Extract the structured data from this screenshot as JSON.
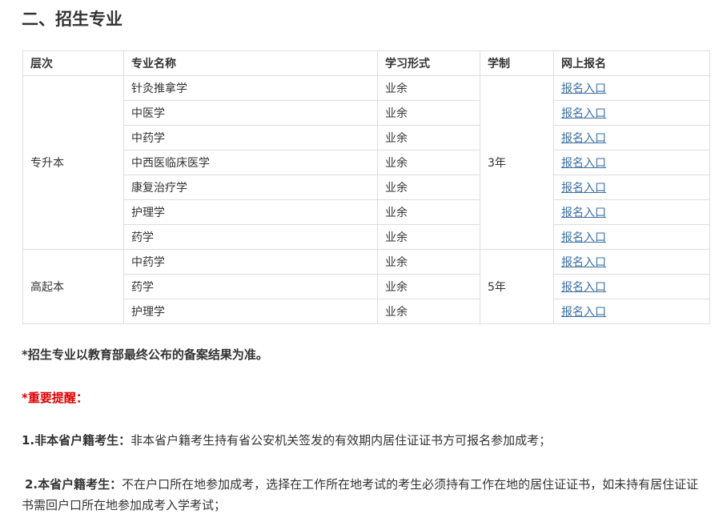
{
  "section_title": "二、招生专业",
  "table": {
    "headers": [
      "层次",
      "专业名称",
      "学习形式",
      "学制",
      "网上报名"
    ],
    "groups": [
      {
        "level": "专升本",
        "duration": "3年",
        "rows": [
          {
            "major": "针灸推拿学",
            "mode": "业余",
            "link": "报名入口"
          },
          {
            "major": "中医学",
            "mode": "业余",
            "link": "报名入口"
          },
          {
            "major": "中药学",
            "mode": "业余",
            "link": "报名入口"
          },
          {
            "major": "中西医临床医学",
            "mode": "业余",
            "link": "报名入口"
          },
          {
            "major": "康复治疗学",
            "mode": "业余",
            "link": "报名入口"
          },
          {
            "major": "护理学",
            "mode": "业余",
            "link": "报名入口"
          },
          {
            "major": "药学",
            "mode": "业余",
            "link": "报名入口"
          }
        ]
      },
      {
        "level": "高起本",
        "duration": "5年",
        "rows": [
          {
            "major": "中药学",
            "mode": "业余",
            "link": "报名入口"
          },
          {
            "major": "药学",
            "mode": "业余",
            "link": "报名入口"
          },
          {
            "major": "护理学",
            "mode": "业余",
            "link": "报名入口"
          }
        ]
      }
    ]
  },
  "notes": {
    "disclaimer": "*招生专业以教育部最终公布的备案结果为准。",
    "important_heading": "*重要提醒：",
    "item1_label": "1.非本省户籍考生：",
    "item1_text": "非本省户籍考生持有省公安机关签发的有效期内居住证证书方可报名参加成考；",
    "item2_label": "2.本省户籍考生：",
    "item2_text": "不在户口所在地参加成考，选择在工作所在地考试的考生必须持有工作在地的居住证证书，如未持有居住证证书需回户口所在地参加成考入学考试；"
  }
}
